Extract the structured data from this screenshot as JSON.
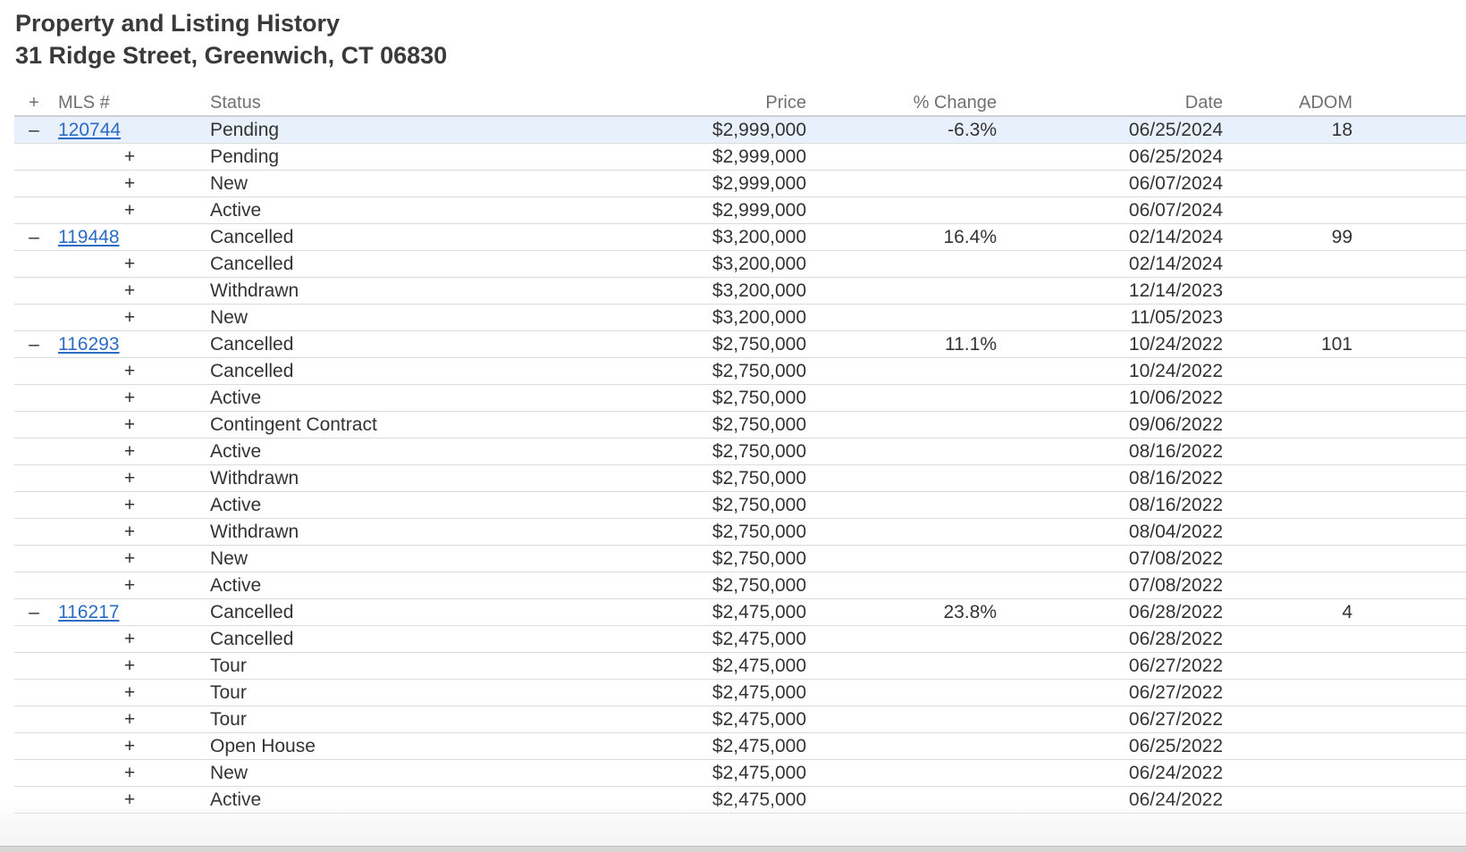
{
  "header": {
    "title": "Property and Listing History",
    "address": "31 Ridge Street, Greenwich, CT 06830"
  },
  "table": {
    "columns": {
      "toggle": "+",
      "mls": "MLS #",
      "status": "Status",
      "price": "Price",
      "change": "% Change",
      "date": "Date",
      "adom": "ADOM"
    },
    "listings": [
      {
        "toggle": "–",
        "mls": "120744",
        "status": "Pending",
        "price": "$2,999,000",
        "change": "-6.3%",
        "date": "06/25/2024",
        "adom": "18",
        "selected": true,
        "events": [
          {
            "toggle": "+",
            "status": "Pending",
            "price": "$2,999,000",
            "date": "06/25/2024"
          },
          {
            "toggle": "+",
            "status": "New",
            "price": "$2,999,000",
            "date": "06/07/2024"
          },
          {
            "toggle": "+",
            "status": "Active",
            "price": "$2,999,000",
            "date": "06/07/2024"
          }
        ]
      },
      {
        "toggle": "–",
        "mls": "119448",
        "status": "Cancelled",
        "price": "$3,200,000",
        "change": "16.4%",
        "date": "02/14/2024",
        "adom": "99",
        "selected": false,
        "events": [
          {
            "toggle": "+",
            "status": "Cancelled",
            "price": "$3,200,000",
            "date": "02/14/2024"
          },
          {
            "toggle": "+",
            "status": "Withdrawn",
            "price": "$3,200,000",
            "date": "12/14/2023"
          },
          {
            "toggle": "+",
            "status": "New",
            "price": "$3,200,000",
            "date": "11/05/2023"
          }
        ]
      },
      {
        "toggle": "–",
        "mls": "116293",
        "status": "Cancelled",
        "price": "$2,750,000",
        "change": "11.1%",
        "date": "10/24/2022",
        "adom": "101",
        "selected": false,
        "events": [
          {
            "toggle": "+",
            "status": "Cancelled",
            "price": "$2,750,000",
            "date": "10/24/2022"
          },
          {
            "toggle": "+",
            "status": "Active",
            "price": "$2,750,000",
            "date": "10/06/2022"
          },
          {
            "toggle": "+",
            "status": "Contingent Contract",
            "price": "$2,750,000",
            "date": "09/06/2022"
          },
          {
            "toggle": "+",
            "status": "Active",
            "price": "$2,750,000",
            "date": "08/16/2022"
          },
          {
            "toggle": "+",
            "status": "Withdrawn",
            "price": "$2,750,000",
            "date": "08/16/2022"
          },
          {
            "toggle": "+",
            "status": "Active",
            "price": "$2,750,000",
            "date": "08/16/2022"
          },
          {
            "toggle": "+",
            "status": "Withdrawn",
            "price": "$2,750,000",
            "date": "08/04/2022"
          },
          {
            "toggle": "+",
            "status": "New",
            "price": "$2,750,000",
            "date": "07/08/2022"
          },
          {
            "toggle": "+",
            "status": "Active",
            "price": "$2,750,000",
            "date": "07/08/2022"
          }
        ]
      },
      {
        "toggle": "–",
        "mls": "116217",
        "status": "Cancelled",
        "price": "$2,475,000",
        "change": "23.8%",
        "date": "06/28/2022",
        "adom": "4",
        "selected": false,
        "events": [
          {
            "toggle": "+",
            "status": "Cancelled",
            "price": "$2,475,000",
            "date": "06/28/2022"
          },
          {
            "toggle": "+",
            "status": "Tour",
            "price": "$2,475,000",
            "date": "06/27/2022"
          },
          {
            "toggle": "+",
            "status": "Tour",
            "price": "$2,475,000",
            "date": "06/27/2022"
          },
          {
            "toggle": "+",
            "status": "Tour",
            "price": "$2,475,000",
            "date": "06/27/2022"
          },
          {
            "toggle": "+",
            "status": "Open House",
            "price": "$2,475,000",
            "date": "06/25/2022"
          },
          {
            "toggle": "+",
            "status": "New",
            "price": "$2,475,000",
            "date": "06/24/2022"
          },
          {
            "toggle": "+",
            "status": "Active",
            "price": "$2,475,000",
            "date": "06/24/2022"
          }
        ]
      }
    ]
  },
  "colors": {
    "link": "#2b6cc4",
    "selected_row": "#e8f1fb",
    "text": "#333333",
    "header_text": "#707070"
  }
}
